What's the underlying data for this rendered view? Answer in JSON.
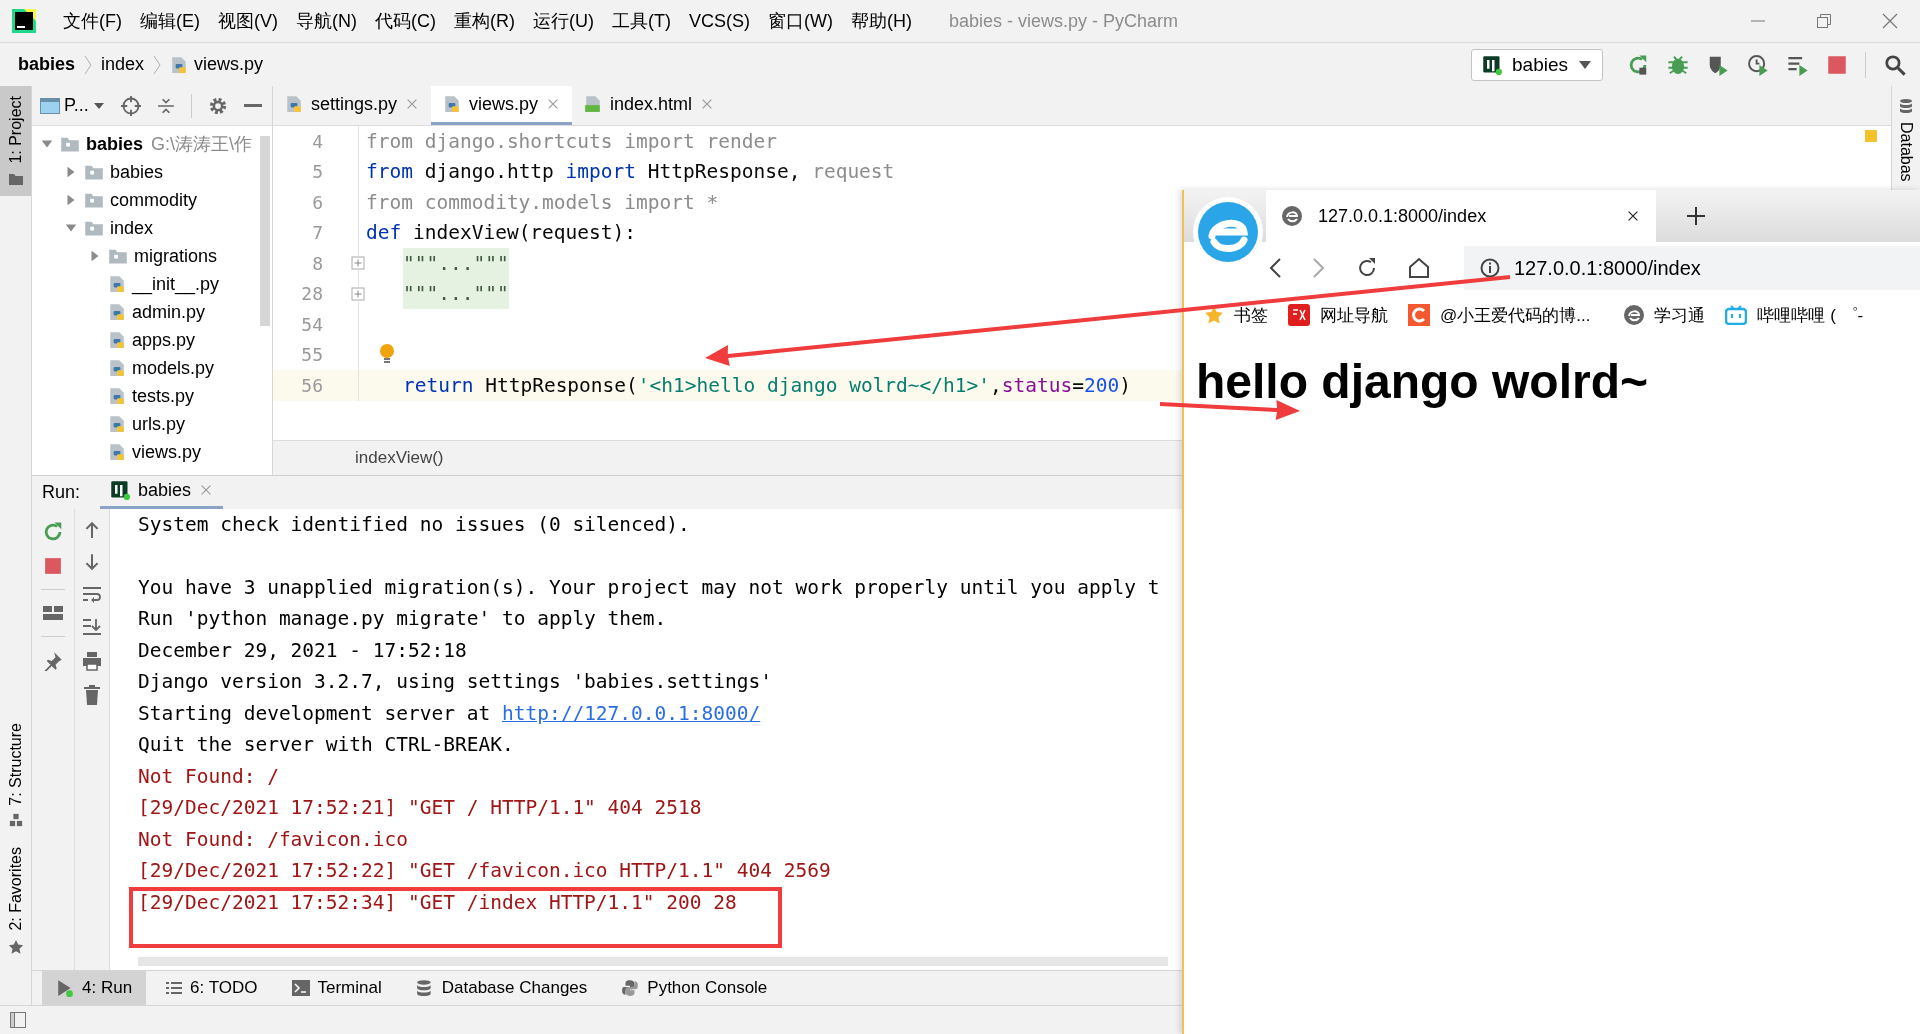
{
  "window": {
    "title": "babies - views.py - PyCharm"
  },
  "menu": [
    "文件(F)",
    "编辑(E)",
    "视图(V)",
    "导航(N)",
    "代码(C)",
    "重构(R)",
    "运行(U)",
    "工具(T)",
    "VCS(S)",
    "窗口(W)",
    "帮助(H)"
  ],
  "breadcrumbs": [
    "babies",
    "index",
    "views.py"
  ],
  "run_config": "babies",
  "left_stripe": [
    {
      "label": "1: Project",
      "selected": true
    },
    {
      "label": "7: Structure",
      "selected": false
    },
    {
      "label": "2: Favorites",
      "selected": false
    }
  ],
  "right_stripe": [
    "Databas"
  ],
  "project_panel": {
    "title": "P...",
    "tree": [
      {
        "label": "babies",
        "path": "G:\\涛涛王\\作",
        "kind": "folder",
        "expanded": true,
        "children": [
          {
            "label": "babies",
            "kind": "folder",
            "expanded": false
          },
          {
            "label": "commodity",
            "kind": "folder",
            "expanded": false
          },
          {
            "label": "index",
            "kind": "folder",
            "expanded": true,
            "children": [
              {
                "label": "migrations",
                "kind": "folder",
                "expanded": false
              },
              {
                "label": "__init__.py",
                "kind": "python"
              },
              {
                "label": "admin.py",
                "kind": "python"
              },
              {
                "label": "apps.py",
                "kind": "python"
              },
              {
                "label": "models.py",
                "kind": "python"
              },
              {
                "label": "tests.py",
                "kind": "python"
              },
              {
                "label": "urls.py",
                "kind": "python"
              },
              {
                "label": "views.py",
                "kind": "python"
              }
            ]
          }
        ]
      }
    ]
  },
  "editor": {
    "tabs": [
      {
        "label": "settings.py",
        "kind": "python",
        "selected": false
      },
      {
        "label": "views.py",
        "kind": "python",
        "selected": true
      },
      {
        "label": "index.html",
        "kind": "html",
        "selected": false
      }
    ],
    "lines": [
      {
        "number": "4",
        "kind": "plain",
        "indented": false,
        "current": false,
        "bulb": false,
        "tokens": [
          {
            "kind": "unused",
            "text": "from django.shortcuts import render"
          }
        ]
      },
      {
        "number": "5",
        "kind": "plain",
        "indented": false,
        "current": false,
        "bulb": false,
        "tokens": [
          {
            "kind": "kw",
            "text": "from"
          },
          {
            "kind": "plain",
            "text": " django.http "
          },
          {
            "kind": "kw",
            "text": "import"
          },
          {
            "kind": "plain",
            "text": " HttpResponse, "
          },
          {
            "kind": "unused",
            "text": "request"
          }
        ]
      },
      {
        "number": "6",
        "kind": "fold-end",
        "indented": false,
        "current": false,
        "bulb": false,
        "tokens": [
          {
            "kind": "unused",
            "text": "from commodity.models import *"
          }
        ]
      },
      {
        "number": "7",
        "kind": "fold-start",
        "indented": false,
        "current": false,
        "bulb": false,
        "tokens": [
          {
            "kind": "kw",
            "text": "def"
          },
          {
            "kind": "plain",
            "text": " indexView(request):"
          }
        ]
      },
      {
        "number": "8",
        "kind": "collapsed",
        "indented": true,
        "current": false,
        "bulb": false,
        "tokens": [
          {
            "kind": "folded",
            "text": "\"\"\"...\"\"\""
          }
        ]
      },
      {
        "number": "28",
        "kind": "collapsed",
        "indented": true,
        "current": false,
        "bulb": false,
        "tokens": [
          {
            "kind": "folded",
            "text": "\"\"\"...\"\"\""
          }
        ]
      },
      {
        "number": "54",
        "kind": "plain",
        "indented": false,
        "current": false,
        "bulb": false
      },
      {
        "number": "55",
        "kind": "plain",
        "indented": false,
        "current": false,
        "bulb": true
      },
      {
        "number": "56",
        "kind": "fold-end",
        "indented": true,
        "current": true,
        "bulb": false,
        "tokens": [
          {
            "kind": "kw",
            "text": "return"
          },
          {
            "kind": "plain",
            "text": " HttpResponse("
          },
          {
            "kind": "string",
            "text": "'<h1>hello django wolrd~</h1>'"
          },
          {
            "kind": "plain",
            "text": ","
          },
          {
            "kind": "param",
            "text": "status"
          },
          {
            "kind": "plain",
            "text": "="
          },
          {
            "kind": "number",
            "text": "200"
          },
          {
            "kind": "plain",
            "text": ")"
          }
        ]
      }
    ],
    "breadcrumb": "indexView()"
  },
  "run_panel": {
    "label": "Run:",
    "tabs": [
      {
        "label": "babies",
        "selected": true
      }
    ],
    "console": [
      {
        "kind": "info",
        "text": "System check identified no issues (0 silenced)."
      },
      {
        "kind": "blank"
      },
      {
        "kind": "info",
        "text": "You have 3 unapplied migration(s). Your project may not work properly until you apply t"
      },
      {
        "kind": "info",
        "text": "Run 'python manage.py migrate' to apply them."
      },
      {
        "kind": "info",
        "text": "December 29, 2021 - 17:52:18"
      },
      {
        "kind": "info",
        "text": "Django version 3.2.7, using settings 'babies.settings'"
      },
      {
        "kind": "link",
        "text": "Starting development server at ",
        "link": "http://127.0.0.1:8000/"
      },
      {
        "kind": "info",
        "text": "Quit the server with CTRL-BREAK."
      },
      {
        "kind": "error",
        "text": "Not Found: /"
      },
      {
        "kind": "error",
        "text": "[29/Dec/2021 17:52:21] \"GET / HTTP/1.1\" 404 2518"
      },
      {
        "kind": "error",
        "text": "Not Found: /favicon.ico"
      },
      {
        "kind": "error",
        "text": "[29/Dec/2021 17:52:22] \"GET /favicon.ico HTTP/1.1\" 404 2569"
      },
      {
        "kind": "error",
        "text": "[29/Dec/2021 17:52:34] \"GET /index HTTP/1.1\" 200 28"
      }
    ]
  },
  "tool_windows": [
    {
      "label": "4: Run",
      "selected": true
    },
    {
      "label": "6: TODO",
      "selected": false
    },
    {
      "label": "Terminal",
      "selected": false
    },
    {
      "label": "Database Changes",
      "selected": false
    },
    {
      "label": "Python Console",
      "selected": false
    }
  ],
  "browser": {
    "tab": "127.0.0.1:8000/index",
    "address": "127.0.0.1:8000/index",
    "bookmarks": [
      "书签",
      "网址导航",
      "@小王爱代码的博...",
      "学习通",
      "哔哩哔哩 ( ゜-"
    ],
    "heading": "hello django wolrd~"
  },
  "annotations": [
    {
      "kind": "arrow"
    },
    {
      "kind": "arrow"
    },
    {
      "kind": "box"
    }
  ]
}
